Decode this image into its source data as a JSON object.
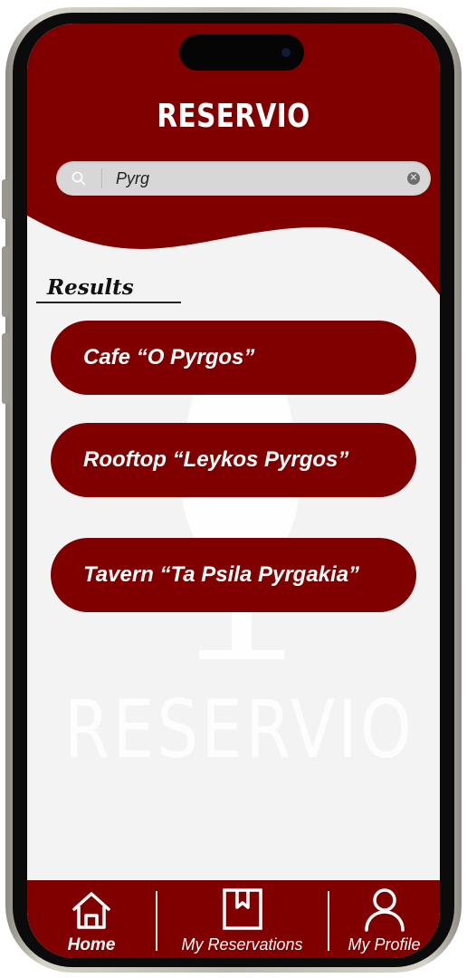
{
  "app": {
    "title": "RESERVIO",
    "watermark_text": "RESERVIO",
    "brand_color": "#800000",
    "background_color": "#f3f3f3"
  },
  "search": {
    "value": "Pyrg",
    "search_icon": "search-icon",
    "clear_icon": "clear-icon"
  },
  "results": {
    "heading": "Results",
    "items": [
      {
        "label": "Cafe “O Pyrgos”"
      },
      {
        "label": "Rooftop “Leykos Pyrgos”"
      },
      {
        "label": "Tavern “Ta Psila Pyrgakia”"
      }
    ]
  },
  "bottom_nav": {
    "items": [
      {
        "label": "Home",
        "icon": "home-icon",
        "active": true
      },
      {
        "label": "My Reservations",
        "icon": "bookmark-icon",
        "active": false
      },
      {
        "label": "My Profile",
        "icon": "profile-icon",
        "active": false
      }
    ]
  }
}
